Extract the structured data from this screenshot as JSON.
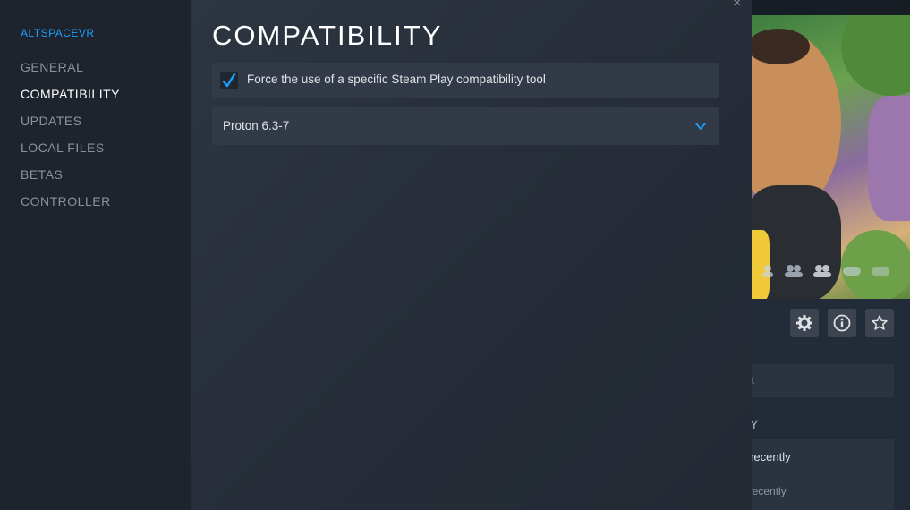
{
  "modal": {
    "game_name": "ALTSPACEVR",
    "nav": [
      {
        "label": "GENERAL",
        "active": false
      },
      {
        "label": "COMPATIBILITY",
        "active": true
      },
      {
        "label": "UPDATES",
        "active": false
      },
      {
        "label": "LOCAL FILES",
        "active": false
      },
      {
        "label": "BETAS",
        "active": false
      },
      {
        "label": "CONTROLLER",
        "active": false
      }
    ],
    "title": "COMPATIBILITY",
    "force_option": {
      "label": "Force the use of a specific Steam Play compatibility tool",
      "checked": true
    },
    "tool_select": {
      "value": "Proton 6.3-7"
    },
    "close_glyph": "×"
  },
  "background": {
    "support_partial": "ort",
    "play_header_partial": "LAY",
    "friends_played_partial": "ed recently",
    "friends_played_partial_2": "ed recently",
    "action_icons": [
      "gear-icon",
      "info-icon",
      "star-icon"
    ]
  },
  "colors": {
    "accent": "#1a9fff",
    "modal_bg": "#2b323d",
    "sidebar_bg": "#1e242d",
    "row_bg": "#323a47"
  }
}
